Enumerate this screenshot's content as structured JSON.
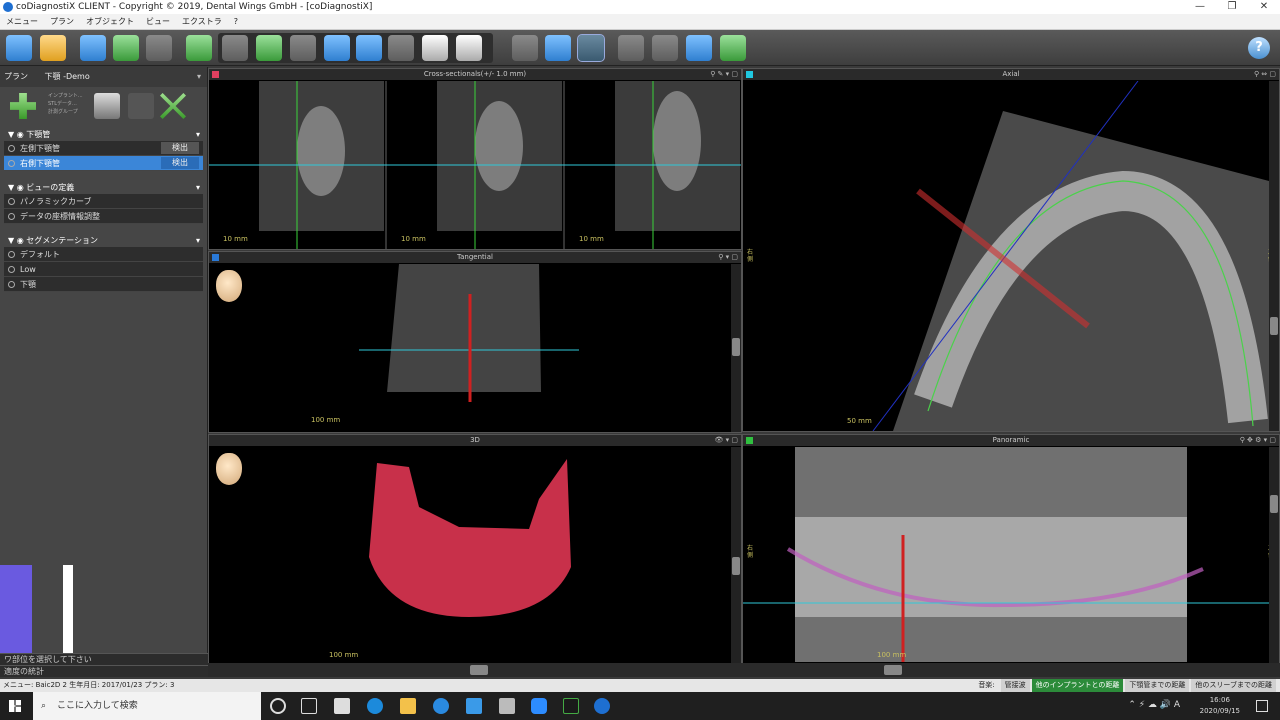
{
  "window": {
    "title": "coDiagnostiX CLIENT - Copyright © 2019, Dental Wings GmbH - [coDiagnostiX]",
    "controls": [
      "—",
      "❐",
      "✕"
    ]
  },
  "menubar": [
    "メニュー",
    "プラン",
    "オブジェクト",
    "ビュー",
    "エクストラ",
    "?"
  ],
  "plan": {
    "label": "プラン",
    "name": "下顎 -Demo",
    "sublabels": [
      "インプラント...",
      "STLデータ...",
      "計測グループ"
    ]
  },
  "sections": [
    {
      "title": "下顎管",
      "rows": [
        {
          "label": "左側下顎管",
          "btn": "検出",
          "selected": false
        },
        {
          "label": "右側下顎管",
          "btn": "検出",
          "selected": true
        }
      ]
    },
    {
      "title": "ビューの定義",
      "rows": [
        {
          "label": "パノラミックカーブ",
          "btn": "",
          "selected": false
        },
        {
          "label": "データの座標情報調整",
          "btn": "",
          "selected": false
        }
      ]
    },
    {
      "title": "セグメンテーション",
      "rows": [
        {
          "label": "デフォルト",
          "btn": "",
          "selected": false
        },
        {
          "label": "Low",
          "btn": "",
          "selected": false
        },
        {
          "label": "下顎",
          "btn": "",
          "selected": false
        }
      ]
    }
  ],
  "left_bottom": [
    "ワ部位を選択して下さい",
    "適度の統計"
  ],
  "views": {
    "cross": {
      "title": "Cross-sectionals(+/- 1.0 mm)",
      "scale": "10 mm",
      "swatch": "#e04060"
    },
    "axial": {
      "title": "Axial",
      "scale": "50 mm",
      "swatch": "#20c8e0",
      "right": "右側",
      "left": "左側"
    },
    "tangential": {
      "title": "Tangential",
      "scale": "100 mm",
      "swatch": "#2a7ad8"
    },
    "threeD": {
      "title": "3D",
      "scale": "100 mm"
    },
    "panoramic": {
      "title": "Panoramic",
      "scale": "100 mm",
      "swatch": "#30c040",
      "right": "右側",
      "left": "左側"
    }
  },
  "status": {
    "left": "メニュー: Baic2D 2     生年月日: 2017/01/23     プラン: 3",
    "label": "音楽:",
    "items": [
      "管接波",
      "他のインプラントとの距離",
      "下顎管までの距離",
      "他のスリーブまでの距離"
    ]
  },
  "taskbar": {
    "search": "ここに入力して検索",
    "time": "16:06",
    "date": "2020/09/15",
    "ime": "A"
  }
}
